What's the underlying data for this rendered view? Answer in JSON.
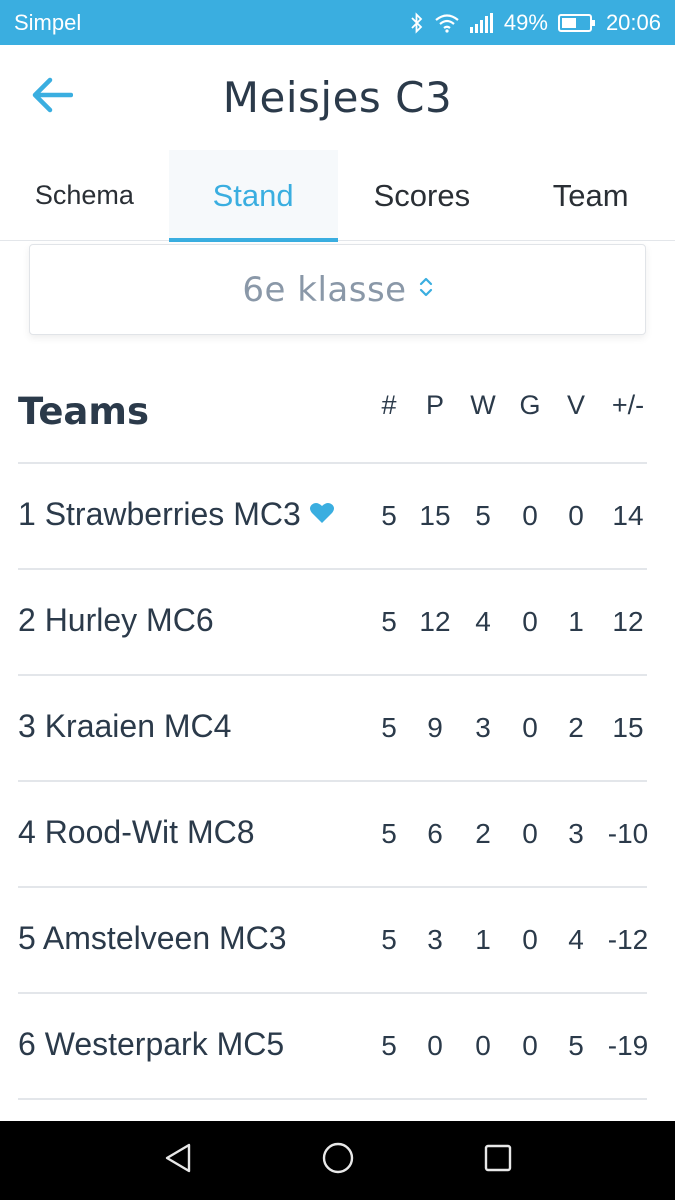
{
  "status_bar": {
    "carrier": "Simpel",
    "battery": "49%",
    "time": "20:06"
  },
  "header": {
    "title": "Meisjes C3"
  },
  "tabs": [
    {
      "label": "Schema",
      "active": false
    },
    {
      "label": "Stand",
      "active": true
    },
    {
      "label": "Scores",
      "active": false
    },
    {
      "label": "Team",
      "active": false
    }
  ],
  "class_select": {
    "selected": "6e klasse"
  },
  "table": {
    "title": "Teams",
    "columns": [
      "#",
      "P",
      "W",
      "G",
      "V",
      "+/-"
    ],
    "rows": [
      {
        "team": "1 Strawberries MC3",
        "favorite": true,
        "values": [
          "5",
          "15",
          "5",
          "0",
          "0",
          "14"
        ]
      },
      {
        "team": "2 Hurley MC6",
        "favorite": false,
        "values": [
          "5",
          "12",
          "4",
          "0",
          "1",
          "12"
        ]
      },
      {
        "team": "3 Kraaien MC4",
        "favorite": false,
        "values": [
          "5",
          "9",
          "3",
          "0",
          "2",
          "15"
        ]
      },
      {
        "team": "4 Rood-Wit MC8",
        "favorite": false,
        "values": [
          "5",
          "6",
          "2",
          "0",
          "3",
          "-10"
        ]
      },
      {
        "team": "5 Amstelveen MC3",
        "favorite": false,
        "values": [
          "5",
          "3",
          "1",
          "0",
          "4",
          "-12"
        ]
      },
      {
        "team": "6 Westerpark MC5",
        "favorite": false,
        "values": [
          "5",
          "0",
          "0",
          "0",
          "5",
          "-19"
        ]
      }
    ]
  },
  "colors": {
    "accent": "#3aaee0",
    "text": "#2b3a4a",
    "muted": "#8a98a8"
  },
  "icons": [
    "back-arrow-icon",
    "bluetooth-icon",
    "wifi-icon",
    "signal-icon",
    "battery-icon",
    "chevron-updown-icon",
    "heart-icon",
    "nav-back-icon",
    "nav-home-icon",
    "nav-recents-icon"
  ]
}
